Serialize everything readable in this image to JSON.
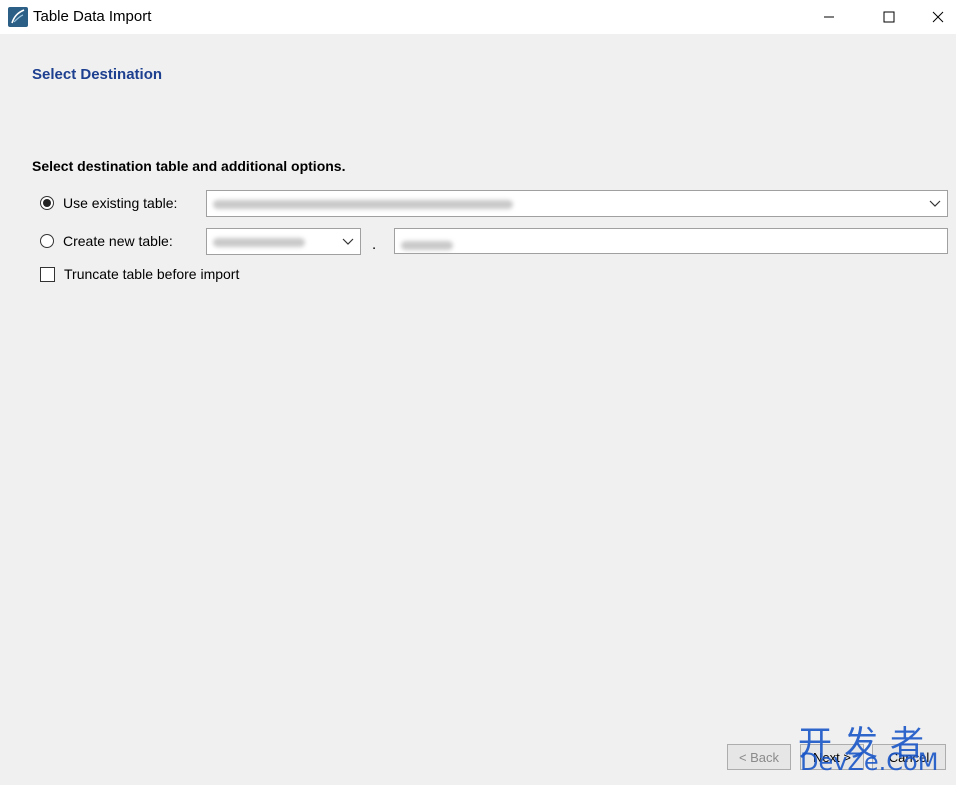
{
  "window": {
    "title": "Table Data Import"
  },
  "page": {
    "heading": "Select Destination",
    "instruction": "Select destination table and additional options."
  },
  "options": {
    "use_existing_label": "Use existing table:",
    "use_existing_selected": true,
    "create_new_label": "Create new table:",
    "create_new_selected": false,
    "separator": ".",
    "truncate_label": "Truncate table before import",
    "truncate_checked": false
  },
  "buttons": {
    "back": "< Back",
    "next": "Next >",
    "cancel": "Cancel"
  },
  "watermark": {
    "chinese": "开发者",
    "latin": "DevZe.CoM"
  },
  "colors": {
    "heading": "#1d3f8f",
    "watermark": "#1a56c8",
    "background": "#f0f0f0"
  }
}
